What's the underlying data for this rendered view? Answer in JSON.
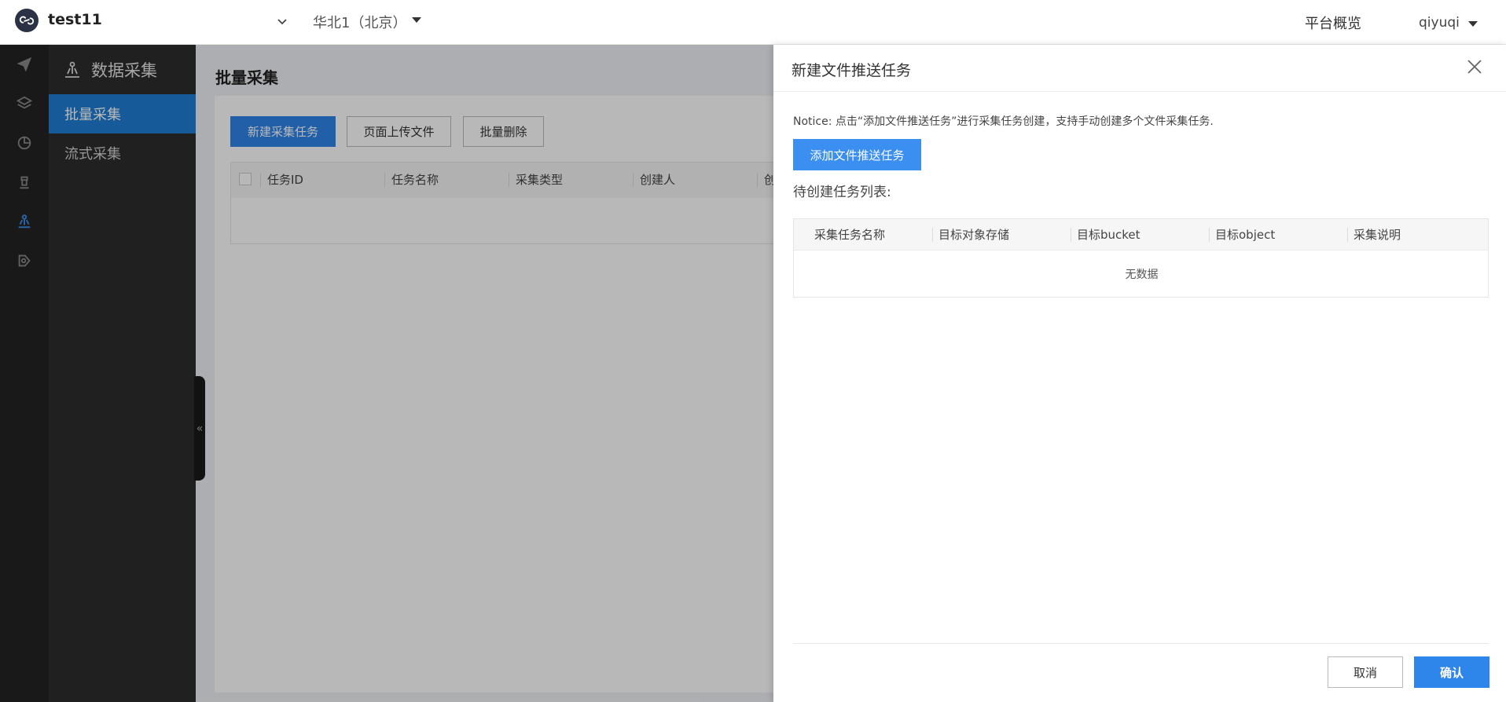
{
  "topbar": {
    "project_name": "test11",
    "region": "华北1（北京）",
    "platform_overview": "平台概览",
    "user": "qiyuqi"
  },
  "icon_rail": {
    "items": [
      {
        "icon": "paper-plane-icon"
      },
      {
        "icon": "layers-icon"
      },
      {
        "icon": "pie-chart-icon"
      },
      {
        "icon": "chess-rook-icon"
      },
      {
        "icon": "data-collect-icon",
        "active": true
      },
      {
        "icon": "settings-flow-icon"
      }
    ]
  },
  "sub_sidebar": {
    "title": "数据采集",
    "items": [
      {
        "label": "批量采集",
        "active": true
      },
      {
        "label": "流式采集"
      }
    ]
  },
  "main": {
    "title": "批量采集",
    "buttons": {
      "new_task": "新建采集任务",
      "upload": "页面上传文件",
      "batch_delete": "批量删除"
    },
    "table": {
      "columns": [
        "任务ID",
        "任务名称",
        "采集类型",
        "创建人",
        "创"
      ]
    }
  },
  "drawer": {
    "title": "新建文件推送任务",
    "notice": "Notice: 点击“添加文件推送任务”进行采集任务创建，支持手动创建多个文件采集任务.",
    "add_button": "添加文件推送任务",
    "pending_label": "待创建任务列表:",
    "table": {
      "columns": [
        "采集任务名称",
        "目标对象存储",
        "目标bucket",
        "目标object",
        "采集说明"
      ],
      "empty_text": "无数据"
    },
    "cancel": "取消",
    "confirm": "确认"
  },
  "colors": {
    "accent": "#2f86ea",
    "sidebar_dark": "#232323",
    "sub_sidebar": "#2d2d2d",
    "active_item": "#1f7dd4"
  }
}
